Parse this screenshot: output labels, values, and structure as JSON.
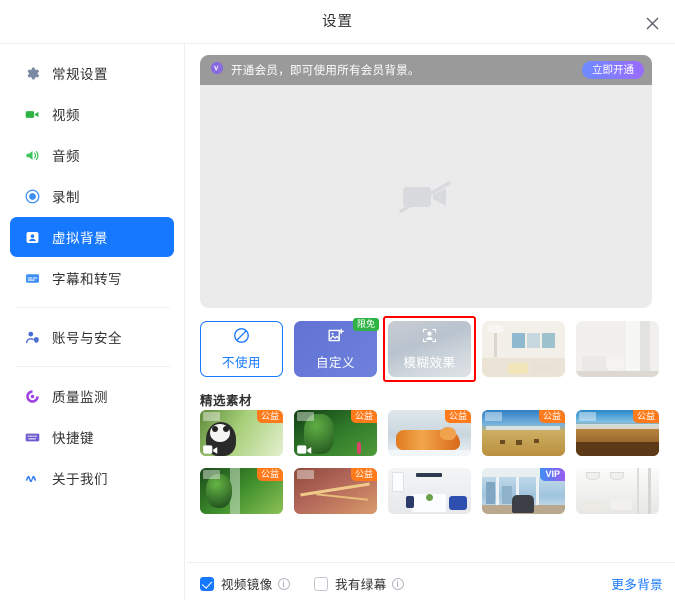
{
  "window": {
    "title": "设置",
    "close_icon": "close-icon"
  },
  "sidebar": {
    "items": [
      {
        "label": "常规设置",
        "icon": "gear-icon",
        "color": "#7b8aa3",
        "active": false
      },
      {
        "label": "视频",
        "icon": "video-camera-icon",
        "color": "#2fb344",
        "active": false
      },
      {
        "label": "音频",
        "icon": "speaker-icon",
        "color": "#3ec25a",
        "active": false
      },
      {
        "label": "录制",
        "icon": "record-circle-icon",
        "color": "#3e8ef7",
        "active": false
      },
      {
        "label": "虚拟背景",
        "icon": "person-card-icon",
        "color": "#ffffff",
        "active": true
      },
      {
        "label": "字幕和转写",
        "icon": "caption-icon",
        "color": "#3e8ef7",
        "active": false
      },
      {
        "divider": true
      },
      {
        "label": "账号与安全",
        "icon": "user-shield-icon",
        "color": "#4a6fd4",
        "active": false
      },
      {
        "divider": true
      },
      {
        "label": "质量监测",
        "icon": "quality-monitor-icon",
        "color": "#a044e3",
        "active": false
      },
      {
        "label": "快捷键",
        "icon": "keyboard-icon",
        "color": "#6d5bd0",
        "active": false
      },
      {
        "label": "关于我们",
        "icon": "about-logo-icon",
        "color": "#2f7bf6",
        "active": false
      }
    ]
  },
  "preview": {
    "banner": {
      "icon": "vip-shield-icon",
      "text": "开通会员，即可使用所有会员背景。",
      "button_label": "立即开通",
      "bg_color": "#9a9a9a"
    },
    "camera_off_icon": "camera-off-icon"
  },
  "options": [
    {
      "name": "none",
      "label": "不使用",
      "icon": "no-entry-icon",
      "selected": true,
      "badge": ""
    },
    {
      "name": "custom",
      "label": "自定义",
      "icon": "image-upload-icon",
      "selected": false,
      "badge": "限免"
    },
    {
      "name": "blur",
      "label": "模糊效果",
      "icon": "portrait-focus-icon",
      "selected": false,
      "badge": "",
      "highlighted": true
    },
    {
      "name": "room-art",
      "label": "",
      "icon": "",
      "selected": false,
      "badge": ""
    },
    {
      "name": "room-white",
      "label": "",
      "icon": "",
      "selected": false,
      "badge": ""
    }
  ],
  "featured": {
    "title": "精选素材",
    "thumbs": [
      {
        "name": "panda",
        "badge": "公益",
        "badge_type": "gy",
        "video": true
      },
      {
        "name": "forest-green",
        "badge": "公益",
        "badge_type": "gy",
        "video": true
      },
      {
        "name": "tiger-snow",
        "badge": "公益",
        "badge_type": "gy",
        "video": false
      },
      {
        "name": "grassland-antelope",
        "badge": "公益",
        "badge_type": "gy",
        "video": false
      },
      {
        "name": "desert-plateau",
        "badge": "公益",
        "badge_type": "gy",
        "video": false
      },
      {
        "name": "waterfall-jungle",
        "badge": "公益",
        "badge_type": "gy",
        "video": false
      },
      {
        "name": "river-delta",
        "badge": "公益",
        "badge_type": "gy",
        "video": false
      },
      {
        "name": "meeting-room",
        "badge": "",
        "badge_type": "",
        "video": false
      },
      {
        "name": "city-office",
        "badge": "VIP",
        "badge_type": "vip",
        "video": false
      },
      {
        "name": "white-office",
        "badge": "",
        "badge_type": "",
        "video": false
      }
    ]
  },
  "bottom": {
    "mirror": {
      "label": "视频镜像",
      "checked": true,
      "info_icon": "info-icon"
    },
    "greenscreen": {
      "label": "我有绿幕",
      "checked": false,
      "info_icon": "info-icon"
    },
    "more_link": "更多背景"
  },
  "colors": {
    "accent": "#1677ff",
    "highlight": "#ff0000",
    "badge_green": "#2fb344",
    "badge_orange": "#ff7a1a"
  }
}
